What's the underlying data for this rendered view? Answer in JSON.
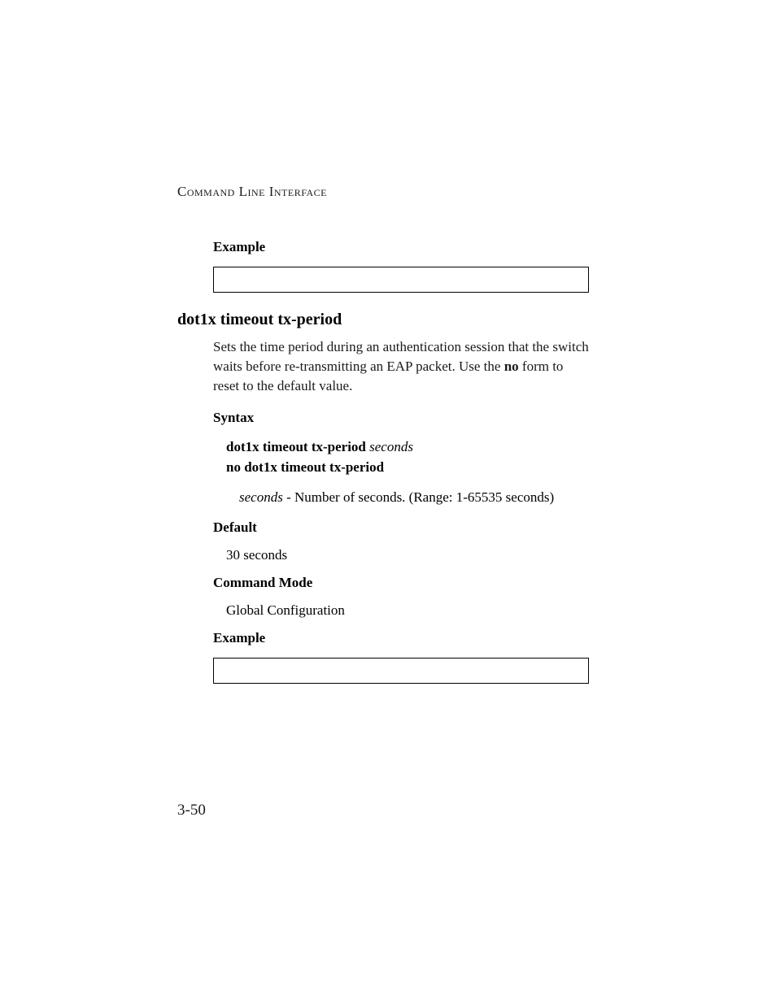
{
  "header": "Command Line Interface",
  "example1_label": "Example",
  "command_heading": "dot1x timeout tx-period",
  "description_part1": "Sets the time period during an authentication session that the switch waits before re-transmitting an EAP packet. Use the ",
  "description_bold": "no",
  "description_part2": " form to reset to the default value.",
  "syntax_label": "Syntax",
  "syntax_line1_bold": "dot1x timeout tx-period",
  "syntax_line1_italic": " seconds",
  "syntax_line2_bold": "no dot1x timeout tx-period",
  "param_italic": "seconds",
  "param_rest": " - Number of seconds. (Range: 1-65535 seconds)",
  "default_label": "Default",
  "default_value": "30 seconds",
  "command_mode_label": "Command Mode",
  "command_mode_value": "Global Configuration",
  "example2_label": "Example",
  "page_number": "3-50"
}
